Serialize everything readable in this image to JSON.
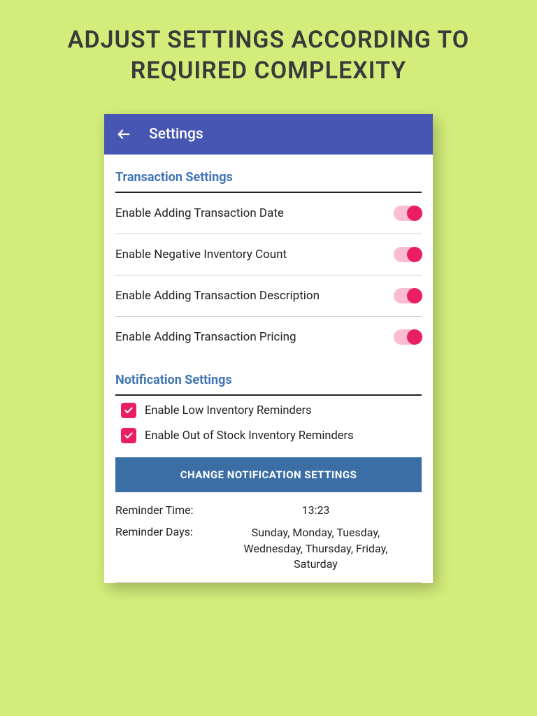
{
  "promo": {
    "title": "ADJUST SETTINGS ACCORDING TO REQUIRED COMPLEXITY"
  },
  "app_bar": {
    "title": "Settings"
  },
  "sections": {
    "transaction": {
      "header": "Transaction Settings",
      "items": [
        {
          "label": "Enable Adding Transaction Date",
          "on": true
        },
        {
          "label": "Enable Negative Inventory Count",
          "on": true
        },
        {
          "label": "Enable Adding Transaction Description",
          "on": true
        },
        {
          "label": "Enable Adding Transaction Pricing",
          "on": true
        }
      ]
    },
    "notification": {
      "header": "Notification Settings",
      "checkboxes": [
        {
          "label": "Enable Low Inventory Reminders",
          "checked": true
        },
        {
          "label": "Enable Out of Stock Inventory Reminders",
          "checked": true
        }
      ],
      "button": "CHANGE NOTIFICATION SETTINGS",
      "reminder_time_label": "Reminder Time:",
      "reminder_time_value": "13:23",
      "reminder_days_label": "Reminder Days:",
      "reminder_days_value": "Sunday, Monday, Tuesday, Wednesday, Thursday, Friday, Saturday"
    }
  }
}
